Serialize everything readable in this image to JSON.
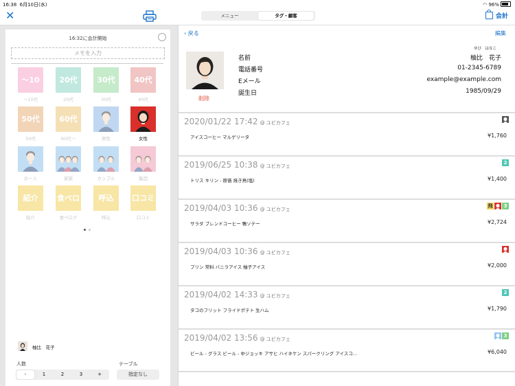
{
  "status": {
    "time": "16:38",
    "date": "6月10日(水)",
    "battery": "96%"
  },
  "topbar": {
    "tabs": [
      "メニュー",
      "タグ・顧客"
    ],
    "checkout_label": "会計"
  },
  "left": {
    "start_time_label": "16:32に会計開始",
    "memo_placeholder": "メモを入力",
    "tiles": [
      {
        "label": "〜10代",
        "caption": "〜10代",
        "color": "#f7a9c9"
      },
      {
        "label": "20代",
        "caption": "20代",
        "color": "#8fd6c4"
      },
      {
        "label": "30代",
        "caption": "30代",
        "color": "#97dba0"
      },
      {
        "label": "40代",
        "caption": "40代",
        "color": "#e59795"
      },
      {
        "label": "50代",
        "caption": "50代",
        "color": "#e8b27d"
      },
      {
        "label": "60代",
        "caption": "60代〜",
        "color": "#eec77b"
      },
      {
        "icon": "man-icon",
        "caption": "男性",
        "color": "#8eb8e6"
      },
      {
        "icon": "woman-icon",
        "caption": "女性",
        "color": "#d9302b",
        "selected": true
      },
      {
        "icon": "single-person-icon",
        "caption": "お一人",
        "color": "#92c4ec"
      },
      {
        "icon": "family-icon",
        "caption": "家族",
        "color": "#92c4ec"
      },
      {
        "icon": "couple-icon",
        "caption": "カップル",
        "color": "#92c4ec"
      },
      {
        "icon": "group-icon",
        "caption": "集団",
        "color": "#ee9eb6"
      },
      {
        "label": "紹介",
        "caption": "紹介",
        "color": "#f2d25c"
      },
      {
        "label": "食べロ",
        "caption": "食べログ",
        "color": "#f2d25c"
      },
      {
        "label": "呼込",
        "caption": "呼込",
        "color": "#f2d25c"
      },
      {
        "label": "口コミ",
        "caption": "口コミ",
        "color": "#f2d25c"
      }
    ],
    "customer_name": "柚比　花子",
    "people_label": "人数",
    "table_label": "テーブル",
    "stepper": [
      "-",
      "1",
      "2",
      "3",
      "+"
    ],
    "table_value": "指定なし"
  },
  "right": {
    "back_label": "戻る",
    "edit_label": "編集",
    "delete_label": "削除",
    "name_ruby": "ゆび　はなこ",
    "fields": [
      {
        "label": "名前",
        "value": "柚比　花子"
      },
      {
        "label": "電話番号",
        "value": "01-2345-6789"
      },
      {
        "label": "Eメール",
        "value": "example@example.com"
      },
      {
        "label": "誕生日",
        "value": "1985/09/29"
      }
    ],
    "history": [
      {
        "datetime": "2020/01/22 17:42",
        "shop": "@ ユビカフェ",
        "items": "アイスコーヒー マルゲリータ",
        "price": "¥1,760",
        "badges": [
          {
            "type": "icon",
            "name": "woman-icon",
            "color": "#555"
          }
        ]
      },
      {
        "datetime": "2019/06/25 10:38",
        "shop": "@ ユビカフェ",
        "items": "トリス キリン - 原価 焼き鳥(塩)",
        "price": "¥1,400",
        "badges": [
          {
            "type": "text",
            "text": "2",
            "color": "#4fc6b3"
          }
        ]
      },
      {
        "datetime": "2019/04/03 10:36",
        "shop": "@ ユビカフェ",
        "items": "サラダ ブレンドコーヒー 鴨ソテー",
        "price": "¥2,724",
        "badges": [
          {
            "type": "text",
            "text": "飛",
            "color": "#f2d25c"
          },
          {
            "type": "icon",
            "name": "woman-icon",
            "color": "#d9302b"
          },
          {
            "type": "text",
            "text": "3",
            "color": "#7fcf86"
          }
        ]
      },
      {
        "datetime": "2019/04/03 10:36",
        "shop": "@ ユビカフェ",
        "items": "プリン 常料 バニラアイス 柚子アイス",
        "price": "¥2,000",
        "badges": [
          {
            "type": "icon",
            "name": "woman-icon",
            "color": "#d9302b"
          }
        ]
      },
      {
        "datetime": "2019/04/02 14:33",
        "shop": "@ ユビカフェ",
        "items": "タコのフリット フライドポテト 生ハム",
        "price": "¥1,790",
        "badges": [
          {
            "type": "text",
            "text": "2",
            "color": "#4fc6b3"
          }
        ]
      },
      {
        "datetime": "2019/04/02 13:56",
        "shop": "@ ユビカフェ",
        "items": "ビール - グラス ビール - 中ジョッキ アサヒ ハイネケン スパークリング アイスコ…",
        "price": "¥6,040",
        "badges": [
          {
            "type": "icon",
            "name": "family-icon",
            "color": "#92c4ec"
          },
          {
            "type": "text",
            "text": "3",
            "color": "#7fcf86"
          }
        ]
      }
    ]
  }
}
